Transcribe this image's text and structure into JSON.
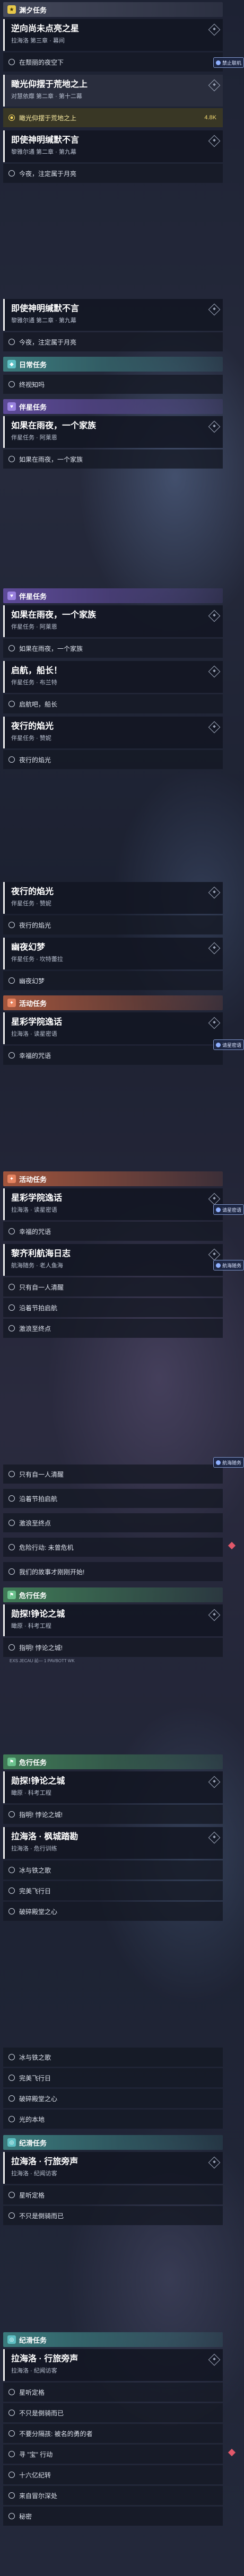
{
  "sections": {
    "s1": {
      "title": "渊夕任务"
    },
    "s2": {
      "title": "日常任务"
    },
    "s3": {
      "title": "伴星任务"
    },
    "s4": {
      "title": "伴星任务"
    },
    "s5": {
      "title": "活动任务"
    },
    "s6": {
      "title": "活动任务"
    },
    "s7": {
      "title": "危行任务"
    },
    "s8": {
      "title": "危行任务"
    },
    "s9": {
      "title": "纪滑任务"
    },
    "s10": {
      "title": "纪滑任务"
    }
  },
  "quests": {
    "q1": {
      "title": "逆向尚未点亮之星",
      "subtitle": "拉海洛 第三章 · 幕间"
    },
    "q2": {
      "title": "瞰光仰摆于荒地之上",
      "subtitle": "对慧依靡 第二章 · 第十二幕"
    },
    "q3": {
      "title": "即使神明缄默不言",
      "subtitle": "黎雅尔通 第二章 · 第九幕"
    },
    "q4": {
      "title": "即使神明缄默不言",
      "subtitle": "黎雅尔通 第二章 · 第九幕"
    },
    "q5": {
      "title": "如果在雨夜，一个家族",
      "subtitle": "伴星任务 · 阿莱恩"
    },
    "q6": {
      "title": "如果在雨夜，一个家族",
      "subtitle": "伴星任务 · 阿莱恩"
    },
    "q7": {
      "title": "启航，船长！",
      "subtitle": "伴星任务 · 布兰特"
    },
    "q8": {
      "title": "夜行的焰光",
      "subtitle": "伴星任务 · 赞妮"
    },
    "q9": {
      "title": "夜行的焰光",
      "subtitle": "伴星任务 · 赞妮"
    },
    "q10": {
      "title": "幽夜幻梦",
      "subtitle": "伴星任务 · 坎特蕾拉"
    },
    "q11": {
      "title": "星彩学院逸话",
      "subtitle": "拉海洛 · 读星密语"
    },
    "q12": {
      "title": "星彩学院逸话",
      "subtitle": "拉海洛 · 读星密语"
    },
    "q13": {
      "title": "黎齐利航海日志",
      "subtitle": "航海随务 · 老人鱼海"
    },
    "q14": {
      "title": "勋探!铮论之城",
      "subtitle": "瞰原 · 科考工程"
    },
    "q15": {
      "title": "勋探!铮论之城",
      "subtitle": "瞰原 · 科考工程"
    },
    "q16": {
      "title": "拉海洛 · 枫城踏勘",
      "subtitle": "拉海洛 · 危行训练"
    },
    "q17": {
      "title": "拉海洛 · 行旅旁声",
      "subtitle": "拉海洛 · 纪闻访客"
    },
    "q18": {
      "title": "拉海洛 · 行旅旁声",
      "subtitle": "拉海洛 · 纪闻访客"
    }
  },
  "steps": {
    "a1": "在颓丽的夜空下",
    "a2": "瞰光仰摆于荒地之上",
    "a2_dist": "4.8K",
    "a3": "今夜，注定属于月亮",
    "a4": "今夜，注定属于月亮",
    "a5": "终视知吗",
    "a6": "如果在雨夜，一个家族",
    "a7": "如果在雨夜，一个家族",
    "a8": "启航吧，船长",
    "a9": "夜行的焰光",
    "a10": "夜行的焰光",
    "a11": "幽夜幻梦",
    "a12": "幸福的咒语",
    "a13": "幸福的咒语",
    "a14": "只有自一人清醒",
    "a15": "沿着节拍启航",
    "a16": "激浪至终点",
    "a17": "只有自一人清醒",
    "a18": "沿着节拍启航",
    "a19": "激浪至终点",
    "a20": "危险行动: 未曾危机",
    "a21": "我们的故事才刚刚开始!",
    "a22": "指明! 悖论之城!",
    "a23": "指明! 悖论之城!",
    "a24": "冰与铁之歌",
    "a25": "完美飞行日",
    "a26": "破碎殿堂之心",
    "a27": "冰与铁之歌",
    "a28": "完美飞行日",
    "a29": "破碎殿堂之心",
    "a30": "光的本地",
    "a31": "星听定格",
    "a32": "不只是倒骑而已",
    "a33": "星听定格",
    "a34": "不只是倒骑而已",
    "a35": "不要分隔孩: 被名的勇的者",
    "a36": "寻 \"宝\" 行动",
    "a37": "十六亿纪转",
    "a38": "来自冒尔深处",
    "a39": "秘密"
  },
  "notes": {
    "n1": "EXS JECAU 前— 1 PAVBOTT WK"
  },
  "badges": {
    "b1": "禁止联机",
    "b2": "4.8K",
    "b3": "请星密语",
    "b4": "请星密语",
    "b5": "航海随务",
    "b6": "航海随务"
  },
  "colors": {
    "main": "#e7c84a",
    "daily": "#5fc0c4",
    "companion": "#9a82e0",
    "event": "#e48360",
    "adventure": "#6cc28e"
  }
}
